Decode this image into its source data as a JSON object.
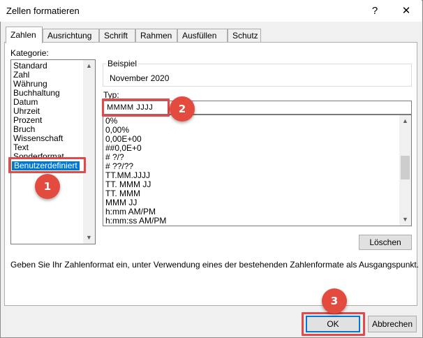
{
  "window": {
    "title": "Zellen formatieren",
    "help_label": "?",
    "close_label": "✕"
  },
  "tabs": [
    {
      "label": "Zahlen",
      "active": true
    },
    {
      "label": "Ausrichtung"
    },
    {
      "label": "Schrift"
    },
    {
      "label": "Rahmen"
    },
    {
      "label": "Ausfüllen"
    },
    {
      "label": "Schutz"
    }
  ],
  "category": {
    "label": "Kategorie:",
    "items": [
      "Standard",
      "Zahl",
      "Währung",
      "Buchhaltung",
      "Datum",
      "Uhrzeit",
      "Prozent",
      "Bruch",
      "Wissenschaft",
      "Text",
      "Sonderformat",
      "Benutzerdefiniert"
    ],
    "selected_index": 11
  },
  "sample": {
    "label": "Beispiel",
    "value": "November 2020"
  },
  "type": {
    "label": "Typ:",
    "value": "MMMM JJJJ",
    "formats": [
      "0%",
      "0,00%",
      "0,00E+00",
      "##0,0E+0",
      "# ?/?",
      "# ??/??",
      "TT.MM.JJJJ",
      "TT. MMM JJ",
      "TT. MMM",
      "MMM JJ",
      "h:mm AM/PM",
      "h:mm:ss AM/PM"
    ]
  },
  "delete_label": "Löschen",
  "hint": "Geben Sie Ihr Zahlenformat ein, unter Verwendung eines der bestehenden Zahlenformate als Ausgangspunkt.",
  "buttons": {
    "ok": "OK",
    "cancel": "Abbrechen"
  },
  "annotations": [
    "1",
    "2",
    "3"
  ],
  "colors": {
    "selection": "#0078d7",
    "annotation": "#e34b3f"
  }
}
